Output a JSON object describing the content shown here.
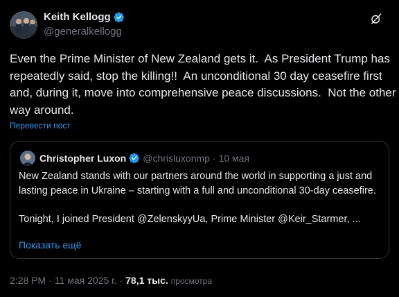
{
  "author": {
    "name": "Keith Kellogg",
    "handle": "@generalkellogg"
  },
  "post": {
    "text": "Even the Prime Minister of New Zealand gets it.  As President Trump has repeatedly said, stop the killing!!  An unconditional 30 day ceasefire first and, during it, move into comprehensive peace discussions.  Not the other way around.",
    "translate_label": "Перевести пост"
  },
  "quote": {
    "name": "Christopher Luxon",
    "handle": "@chrisluxonmp",
    "separator": "·",
    "date": "10 мая",
    "text": "New Zealand stands with our partners around the world in supporting a just and lasting peace in Ukraine – starting with a full and unconditional 30-day ceasefire.\n\nTonight, I joined President @ZelenskyyUa, Prime Minister @Keir_Starmer, ...",
    "show_more": "Показать ещё"
  },
  "meta": {
    "time": "2:28 PM",
    "separator": "·",
    "date": "11 мая 2025 г.",
    "separator2": "·",
    "views_count": "78,1 тыс.",
    "views_label": "просмотра"
  },
  "colors": {
    "background": "#000000",
    "text": "#e7e9ea",
    "muted": "#71767b",
    "link": "#1d9bf0",
    "verified": "#1d9bf0",
    "border": "#2f3336"
  },
  "icons": {
    "verified": "verified-badge-icon",
    "grok": "grok-icon"
  }
}
